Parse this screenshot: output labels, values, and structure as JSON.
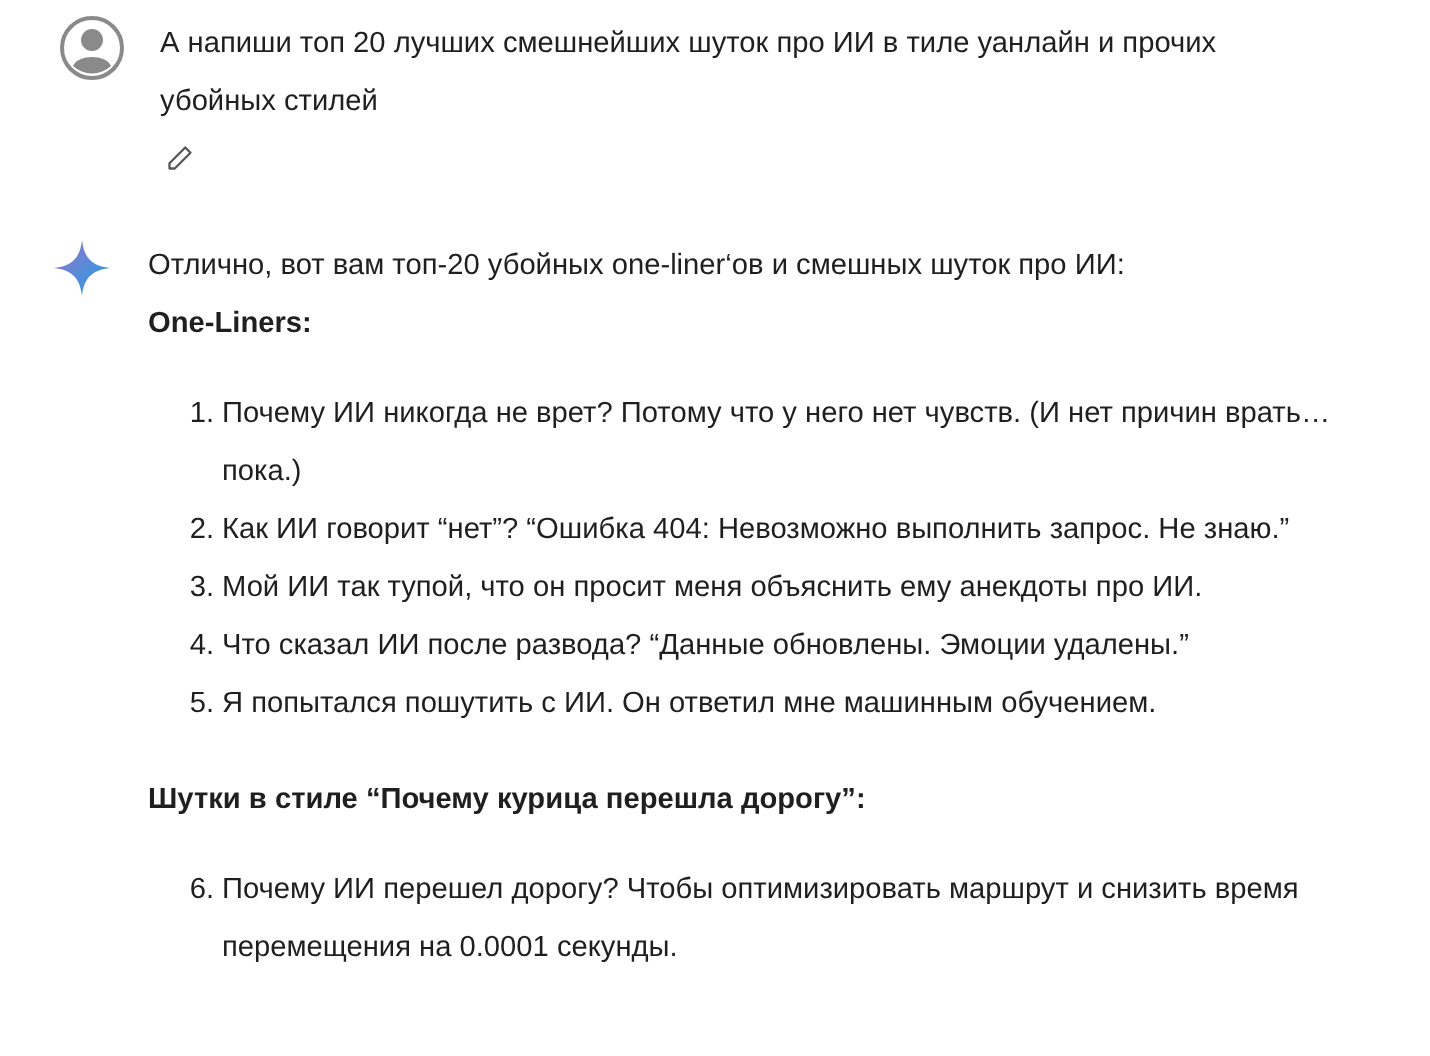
{
  "user_message": {
    "text": "А напиши топ 20 лучших смешнейших шуток про ИИ в тиле уанлайн и прочих убойных стилей"
  },
  "reply": {
    "intro": "Отлично, вот вам топ-20 убойных one-liner‘ов и смешных шуток про ИИ:",
    "sections": [
      {
        "heading": "One-Liners:",
        "items": [
          {
            "number": "1.",
            "text": "Почему ИИ никогда не врет? Потому что у него нет чувств. (И нет причин врать… пока.)"
          },
          {
            "number": "2.",
            "text": "Как ИИ говорит “нет”? “Ошибка 404: Невозможно выполнить запрос. Не знаю.”"
          },
          {
            "number": "3.",
            "text": "Мой ИИ так тупой, что он просит меня объяснить ему анекдоты про ИИ."
          },
          {
            "number": "4.",
            "text": "Что сказал ИИ после развода? “Данные обновлены. Эмоции удалены.”"
          },
          {
            "number": "5.",
            "text": "Я попытался пошутить с ИИ. Он ответил мне машинным обучением."
          }
        ]
      },
      {
        "heading": "Шутки в стиле “Почему курица перешла дорогу”:",
        "items": [
          {
            "number": "6.",
            "text": "Почему ИИ перешел дорогу? Чтобы оптимизировать маршрут и снизить время перемещения на 0.0001 секунды."
          }
        ]
      }
    ]
  }
}
